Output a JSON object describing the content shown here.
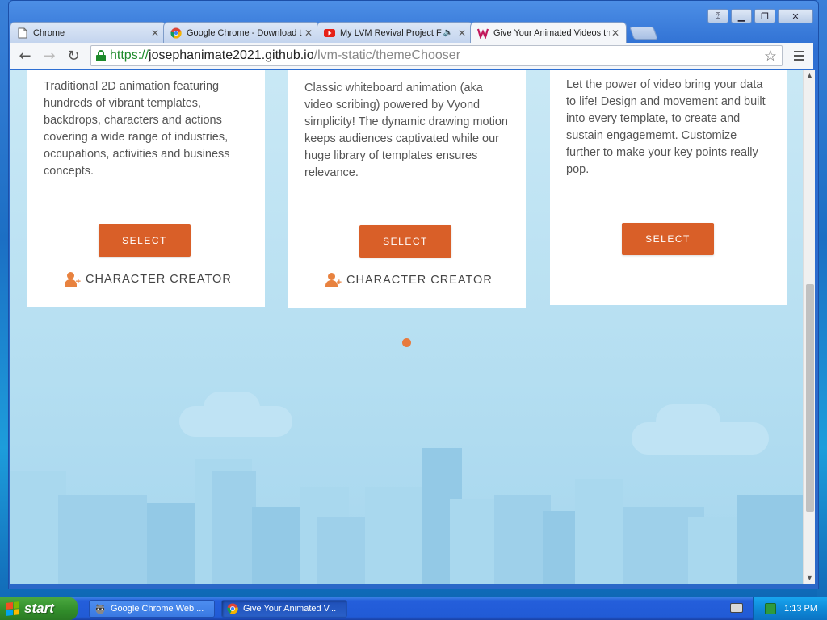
{
  "window": {
    "controls": {
      "help": "⍰",
      "minimize": "▁",
      "restore": "❐",
      "close": "✕"
    }
  },
  "tabs": [
    {
      "label": "Chrome",
      "icon": "page-icon",
      "active": false
    },
    {
      "label": "Google Chrome - Download t",
      "icon": "chrome-icon",
      "active": false
    },
    {
      "label": "My LVM Revival Project F",
      "icon": "youtube-icon",
      "active": false,
      "audio": true
    },
    {
      "label": "Give Your Animated Videos th",
      "icon": "site-w-icon",
      "active": true
    }
  ],
  "toolbar": {
    "back": "←",
    "forward": "→",
    "reload": "↻",
    "url_scheme": "https://",
    "url_host": "josephanimate2021.github.io",
    "url_path": "/lvm-static/themeChooser",
    "star": "☆"
  },
  "cards": [
    {
      "description": "Traditional 2D animation featuring hundreds of vibrant templates, backdrops, characters and actions covering a wide range of industries, occupations, activities and business concepts.",
      "select_label": "SELECT",
      "character_creator": "CHARACTER CREATOR"
    },
    {
      "description": "Classic whiteboard animation (aka video scribing) powered by Vyond simplicity! The dynamic drawing motion keeps audiences captivated while our huge library of templates ensures relevance.",
      "select_label": "SELECT",
      "character_creator": "CHARACTER CREATOR"
    },
    {
      "description": "Let the power of video bring your data to life! Design and movement and built into every template, to create and sustain engagememt. Customize further to make your key points really pop.",
      "select_label": "SELECT"
    }
  ],
  "taskbar": {
    "start_label": "start",
    "buttons": [
      {
        "label": "Google Chrome Web ...",
        "icon": "raccoon-icon",
        "active": false
      },
      {
        "label": "Give Your Animated V...",
        "icon": "chrome-icon",
        "active": true
      }
    ],
    "clock": "1:13 PM"
  },
  "colors": {
    "accent": "#d95f28",
    "accent_icon": "#e8823f",
    "page_bg": "#b4def1",
    "url_secure": "#1d8a2a"
  }
}
